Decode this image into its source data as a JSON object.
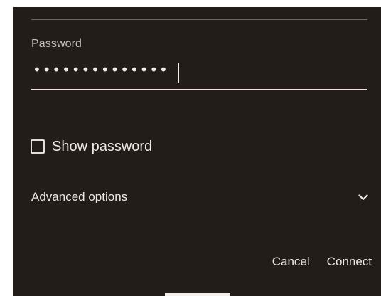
{
  "password": {
    "label": "Password",
    "value": "••••••••••••••"
  },
  "show_password": {
    "label": "Show password",
    "checked": false
  },
  "advanced": {
    "label": "Advanced options",
    "icon": "chevron-down-icon"
  },
  "actions": {
    "cancel_label": "Cancel",
    "connect_label": "Connect"
  },
  "colors": {
    "dialog_bg": "#231d19",
    "text": "#efe7e3",
    "underline_active": "#f1e4de"
  }
}
